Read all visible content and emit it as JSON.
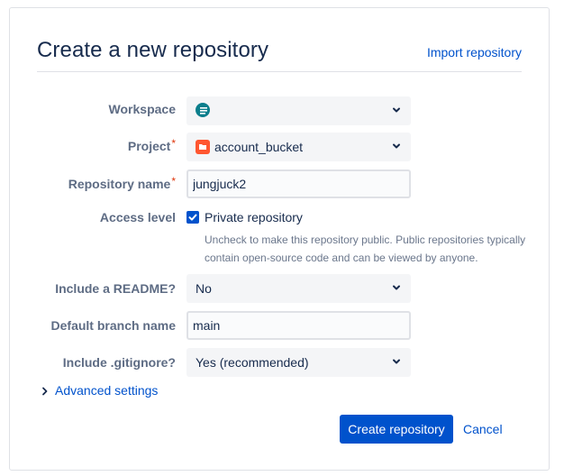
{
  "page": {
    "title": "Create a new repository",
    "import_link": "Import repository"
  },
  "form": {
    "workspace": {
      "label": "Workspace",
      "value": ""
    },
    "project": {
      "label": "Project",
      "required_mark": "*",
      "value": "account_bucket"
    },
    "repo_name": {
      "label": "Repository name",
      "required_mark": "*",
      "value": "jungjuck2"
    },
    "access": {
      "label": "Access level",
      "checkbox_label": "Private repository",
      "checked": true,
      "helper": "Uncheck to make this repository public. Public repositories typically contain open-source code and can be viewed by anyone."
    },
    "readme": {
      "label": "Include a README?",
      "value": "No"
    },
    "branch": {
      "label": "Default branch name",
      "value": "main"
    },
    "gitignore": {
      "label": "Include .gitignore?",
      "value": "Yes (recommended)"
    }
  },
  "advanced": {
    "label": "Advanced settings"
  },
  "actions": {
    "create": "Create repository",
    "cancel": "Cancel"
  },
  "colors": {
    "primary": "#0052cc",
    "project_icon": "#ff5630",
    "required": "#de350b"
  }
}
